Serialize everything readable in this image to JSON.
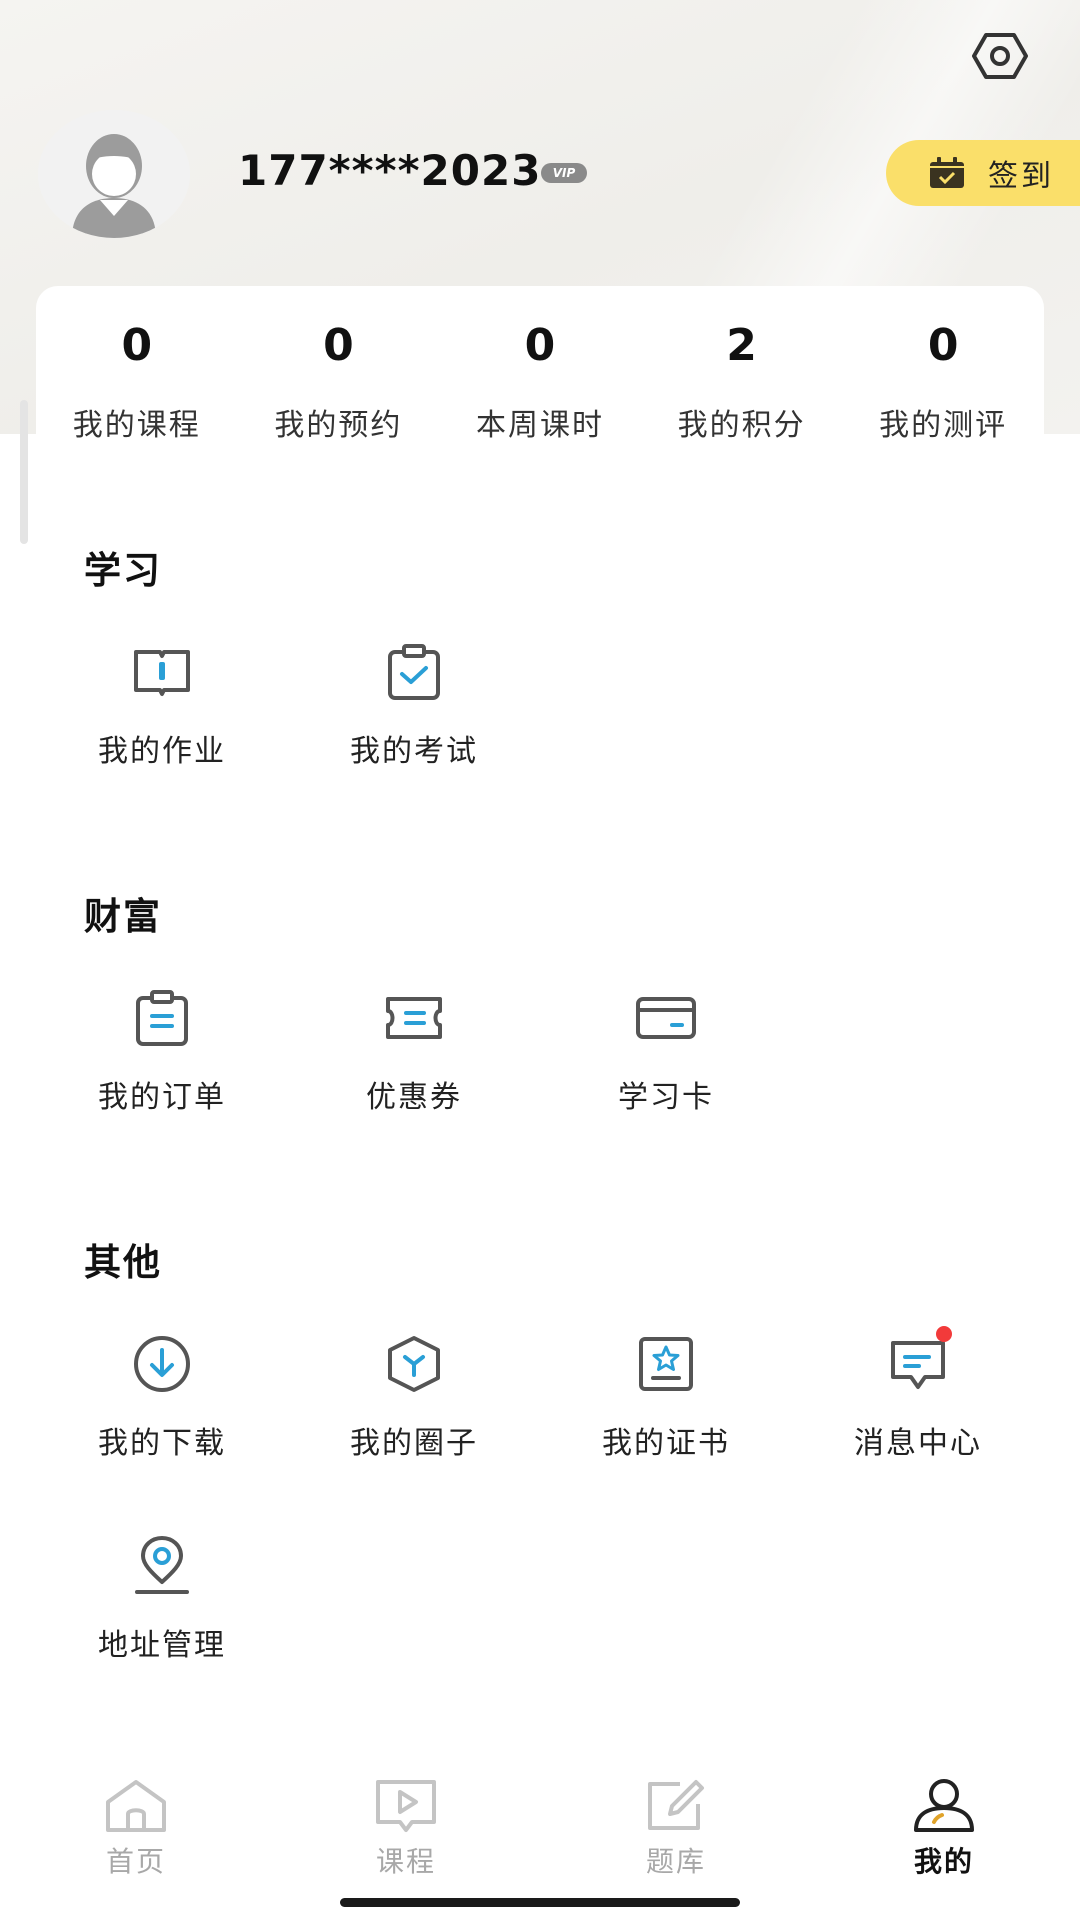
{
  "header": {
    "username": "177****2023",
    "vip_label": "VIP",
    "signin_label": "签到"
  },
  "stats": [
    {
      "value": "0",
      "label": "我的课程"
    },
    {
      "value": "0",
      "label": "我的预约"
    },
    {
      "value": "0",
      "label": "本周课时"
    },
    {
      "value": "2",
      "label": "我的积分"
    },
    {
      "value": "0",
      "label": "我的测评"
    }
  ],
  "sections": {
    "study": {
      "title": "学习",
      "items": [
        {
          "label": "我的作业",
          "icon": "book-icon"
        },
        {
          "label": "我的考试",
          "icon": "clipboard-check-icon"
        }
      ]
    },
    "wealth": {
      "title": "财富",
      "items": [
        {
          "label": "我的订单",
          "icon": "order-list-icon"
        },
        {
          "label": "优惠券",
          "icon": "coupon-icon"
        },
        {
          "label": "学习卡",
          "icon": "card-icon"
        }
      ]
    },
    "other": {
      "title": "其他",
      "items": [
        {
          "label": "我的下载",
          "icon": "download-icon"
        },
        {
          "label": "我的圈子",
          "icon": "circle-hexagon-icon"
        },
        {
          "label": "我的证书",
          "icon": "certificate-icon"
        },
        {
          "label": "消息中心",
          "icon": "message-icon"
        },
        {
          "label": "地址管理",
          "icon": "location-pin-icon"
        }
      ]
    }
  },
  "tabbar": [
    {
      "label": "首页",
      "icon": "home-icon",
      "active": false
    },
    {
      "label": "课程",
      "icon": "course-play-icon",
      "active": false
    },
    {
      "label": "题库",
      "icon": "edit-icon",
      "active": false
    },
    {
      "label": "我的",
      "icon": "user-icon",
      "active": true
    }
  ],
  "colors": {
    "accent_blue": "#2a9fd6",
    "icon_gray": "#555555",
    "signin_yellow": "#fadf6a",
    "badge_red": "#f23a3a"
  }
}
